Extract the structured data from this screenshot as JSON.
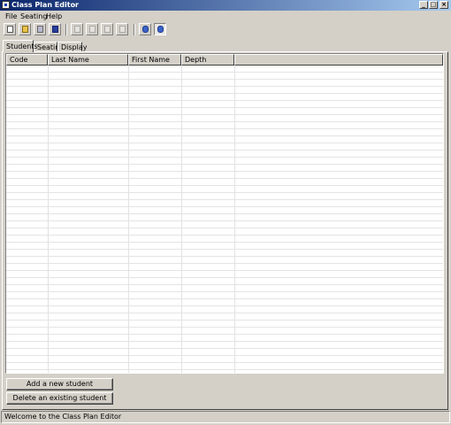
{
  "window": {
    "title": "Class Plan Editor",
    "controls": {
      "minimize": "_",
      "maximize": "□",
      "close": "×"
    }
  },
  "menu": {
    "file": "File",
    "seating": "Seating",
    "help": "Help"
  },
  "toolbar": {
    "buttons": [
      {
        "icon": "new-document-icon",
        "enabled": true
      },
      {
        "icon": "open-folder-icon",
        "enabled": true
      },
      {
        "icon": "save-icon",
        "enabled": true
      },
      {
        "icon": "save-as-icon",
        "enabled": true
      },
      {
        "icon": "edit-icon",
        "enabled": false
      },
      {
        "icon": "edit-alt-icon",
        "enabled": false
      },
      {
        "icon": "blank-icon",
        "enabled": false
      },
      {
        "icon": "image-icon",
        "enabled": false
      },
      {
        "icon": "about-icon",
        "enabled": true
      },
      {
        "icon": "info-icon",
        "enabled": true,
        "pressed": true
      }
    ]
  },
  "tabs": {
    "students": "Students",
    "seating": "Seating",
    "display": "Display",
    "active": "Students"
  },
  "table": {
    "columns": [
      "Code",
      "Last Name",
      "First Name",
      "Depth",
      ""
    ],
    "rows": []
  },
  "actions": {
    "add": "Add a new student",
    "delete": "Delete an existing student"
  },
  "status": {
    "text": "Welcome to the Class Plan Editor"
  }
}
